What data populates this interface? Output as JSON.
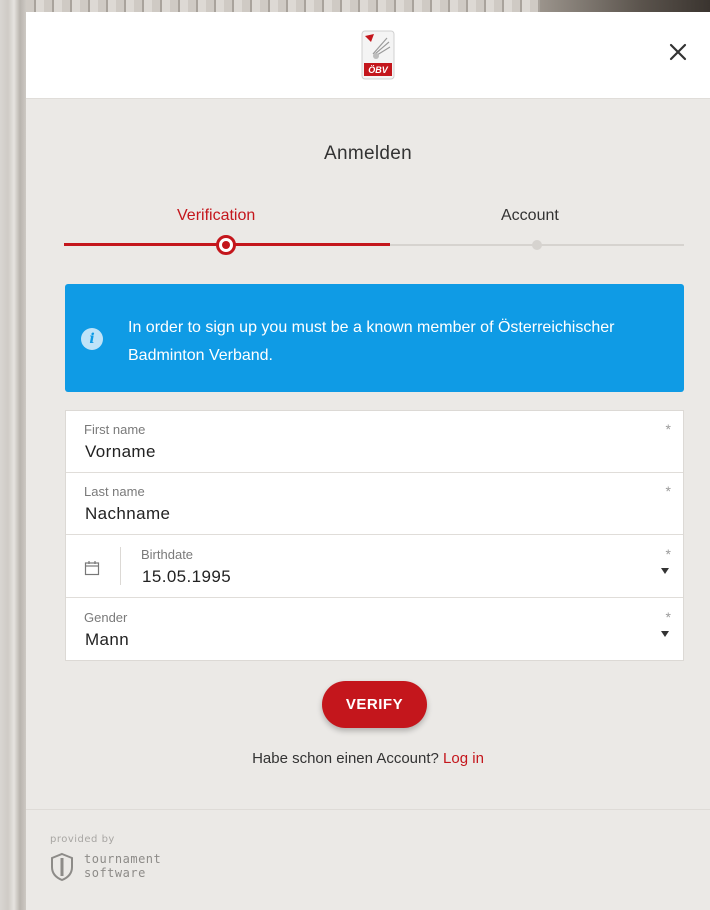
{
  "dialog": {
    "title": "Anmelden",
    "close_icon": "close-icon"
  },
  "logo": {
    "text": "ÖBV",
    "accent": "#c4161c"
  },
  "stepper": {
    "steps": [
      {
        "label": "Verification",
        "active": true
      },
      {
        "label": "Account",
        "active": false
      }
    ],
    "accent": "#c4161c",
    "inactive": "#d6d3cf"
  },
  "info": {
    "icon": "info-icon",
    "message": "In order to sign up you must be a known member of Österreichischer Badminton Verband.",
    "color": "#0f9be5"
  },
  "form": {
    "first_name": {
      "label": "First name",
      "value": "Vorname",
      "required": "*"
    },
    "last_name": {
      "label": "Last name",
      "value": "Nachname",
      "required": "*"
    },
    "birthdate": {
      "label": "Birthdate",
      "value": "15.05.1995",
      "required": "*",
      "icon": "calendar-icon"
    },
    "gender": {
      "label": "Gender",
      "value": "Mann",
      "required": "*"
    }
  },
  "actions": {
    "verify_label": "VERIFY",
    "login_prompt": "Habe schon einen Account?",
    "login_link": "Log in"
  },
  "footer": {
    "provided_by": "provided by",
    "brand_line1": "tournament",
    "brand_line2": "software"
  }
}
